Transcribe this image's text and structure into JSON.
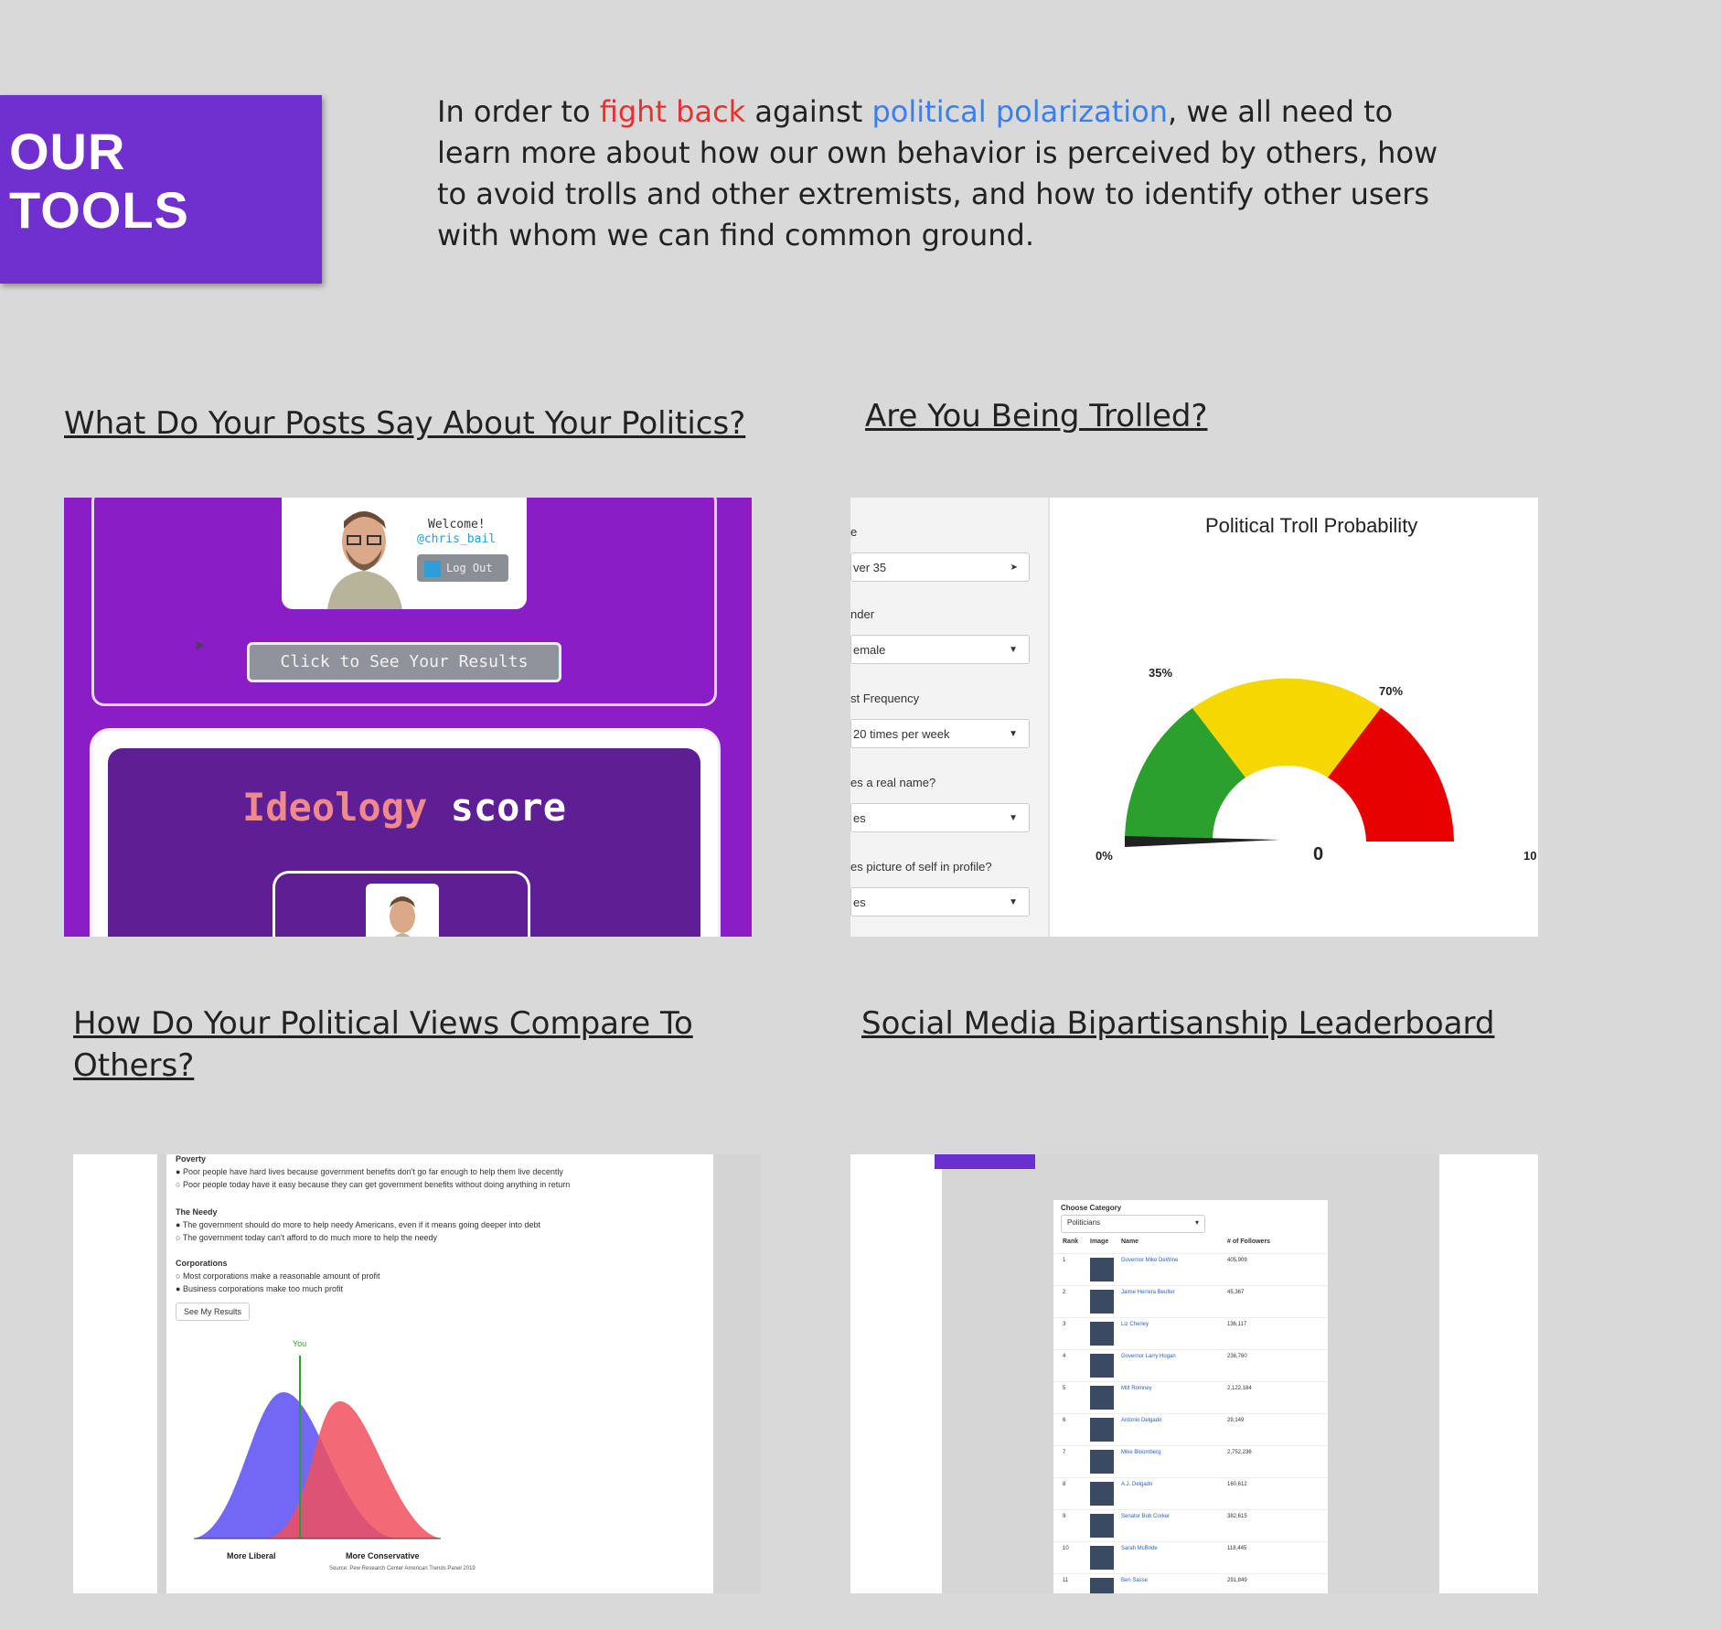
{
  "banner": {
    "title_line1": "OUR",
    "title_line2": "TOOLS"
  },
  "intro": {
    "part1": "In order to ",
    "highlight_red": "fight back",
    "part2": " against ",
    "highlight_blue": "political polarization",
    "part3": ", we all need to learn more about how our own behavior is perceived by others, how to avoid trolls and other extremists, and how to identify other users with whom we can find common ground.",
    "colors": {
      "red": "#e8312f",
      "blue": "#3a7ff0"
    }
  },
  "tools": {
    "posts": {
      "title": "What Do Your Posts Say About Your Politics?",
      "welcome": "Welcome!",
      "handle": "@chris_bail",
      "logout": "Log Out",
      "results_button": "Click to See Your Results",
      "score_word1": "Ideology",
      "score_word2": "score"
    },
    "trolled": {
      "title": "Are You Being Trolled?",
      "gauge_title": "Political Troll Probability",
      "label_0": "0%",
      "label_35": "35%",
      "label_70": "70%",
      "label_100": "10",
      "value": "0",
      "fields": [
        {
          "label": "e",
          "value": "ver 35"
        },
        {
          "label": "nder",
          "value": "emale"
        },
        {
          "label": "st Frequency",
          "value": "20 times per week"
        },
        {
          "label": "es a real name?",
          "value": "es"
        },
        {
          "label": "es picture of self in profile?",
          "value": "es"
        }
      ]
    },
    "compare": {
      "title": "How Do Your Political Views Compare To Others?",
      "q1": "Poverty",
      "q1a": "Poor people have hard lives because government benefits don't go far enough to help them live decently",
      "q1b": "Poor people today have it easy because they can get government benefits without doing anything in return",
      "q2": "The Needy",
      "q2a": "The government should do more to help needy Americans, even if it means going deeper into debt",
      "q2b": "The government today can't afford to do much more to help the needy",
      "q3": "Corporations",
      "q3a": "Most corporations make a reasonable amount of profit",
      "q3b": "Business corporations make too much profit",
      "button": "See My Results",
      "you": "You",
      "x_left": "More Liberal",
      "x_right": "More Conservative",
      "source": "Source: Pew Research Center American Trends Panel 2019",
      "colors": {
        "liberal": "#5b4ef5",
        "conservative": "#f0505e"
      }
    },
    "leaderboard": {
      "title": "Social Media Bipartisanship Leaderboard",
      "category_label": "Choose Category",
      "category_value": "Politicians",
      "headers": [
        "Rank",
        "Image",
        "Name",
        "# of Followers"
      ],
      "rows": [
        {
          "rank": "1",
          "name": "Governor Mike DeWine",
          "followers": "405,909"
        },
        {
          "rank": "2",
          "name": "Jaime Herrera Beutler",
          "followers": "45,367"
        },
        {
          "rank": "3",
          "name": "Liz Cheney",
          "followers": "136,117"
        },
        {
          "rank": "4",
          "name": "Governor Larry Hogan",
          "followers": "236,760"
        },
        {
          "rank": "5",
          "name": "Mitt Romney",
          "followers": "2,122,184"
        },
        {
          "rank": "6",
          "name": "Antonio Delgado",
          "followers": "29,149"
        },
        {
          "rank": "7",
          "name": "Mike Bloomberg",
          "followers": "2,752,236"
        },
        {
          "rank": "8",
          "name": "A.J. Delgado",
          "followers": "160,612"
        },
        {
          "rank": "9",
          "name": "Senator Bob Corker",
          "followers": "382,615"
        },
        {
          "rank": "10",
          "name": "Sarah McBride",
          "followers": "118,445"
        },
        {
          "rank": "11",
          "name": "Ben Sasse",
          "followers": "291,849"
        }
      ]
    }
  }
}
